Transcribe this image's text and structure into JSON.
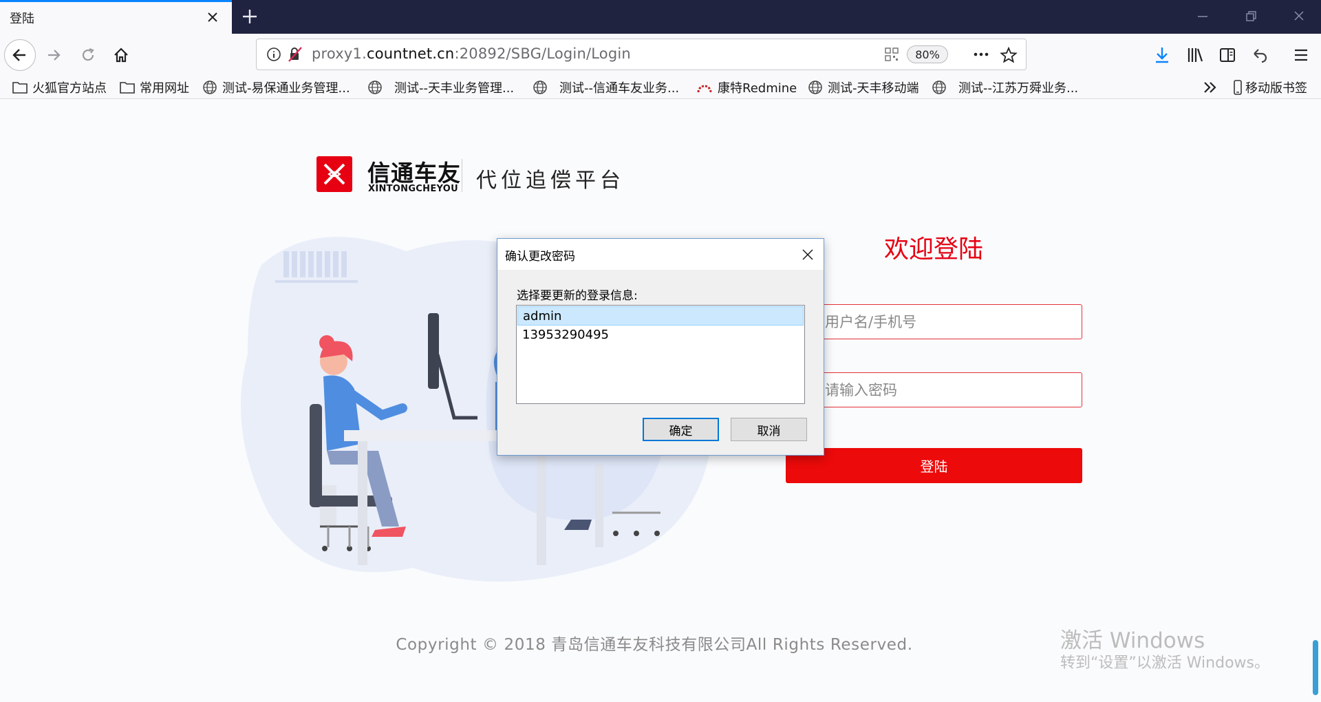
{
  "browser": {
    "tab_title": "登陆",
    "url_prefix": "proxy1.",
    "url_host": "countnet.cn",
    "url_rest": ":20892/SBG/Login/Login",
    "zoom": "80%"
  },
  "bookmarks": [
    {
      "label": "火狐官方站点",
      "icon": "folder-icon"
    },
    {
      "label": "常用网址",
      "icon": "folder-icon"
    },
    {
      "label": "测试-易保通业务管理...",
      "icon": "globe-icon"
    },
    {
      "label": "测试--天丰业务管理...",
      "icon": "globe-icon"
    },
    {
      "label": "测试--信通车友业务...",
      "icon": "globe-icon"
    },
    {
      "label": "康特Redmine",
      "icon": "redmine-icon"
    },
    {
      "label": "测试-天丰移动端",
      "icon": "globe-icon"
    },
    {
      "label": "测试--江苏万舜业务...",
      "icon": "globe-icon"
    },
    {
      "label": "移动版书签",
      "icon": "mobile-icon"
    }
  ],
  "page": {
    "brand_cn": "信通车友",
    "brand_en": "XINTONGCHEYOU",
    "slogan": "代位追偿平台",
    "welcome": "欢迎登陆",
    "username_placeholder": "用户名/手机号",
    "password_placeholder": "请输入密码",
    "login_label": "登陆",
    "copyright": "Copyright © 2018 青岛信通车友科技有限公司All Rights Reserved."
  },
  "watermark": {
    "line1": "激活 Windows",
    "line2": "转到“设置”以激活 Windows。"
  },
  "dialog": {
    "title": "确认更改密码",
    "label": "选择要更新的登录信息:",
    "items": [
      "admin",
      "13953290495"
    ],
    "ok": "确定",
    "cancel": "取消"
  },
  "colors": {
    "brand_red": "#e60012",
    "accent_blue": "#0a84ff",
    "tabstrip": "#1f2340"
  }
}
